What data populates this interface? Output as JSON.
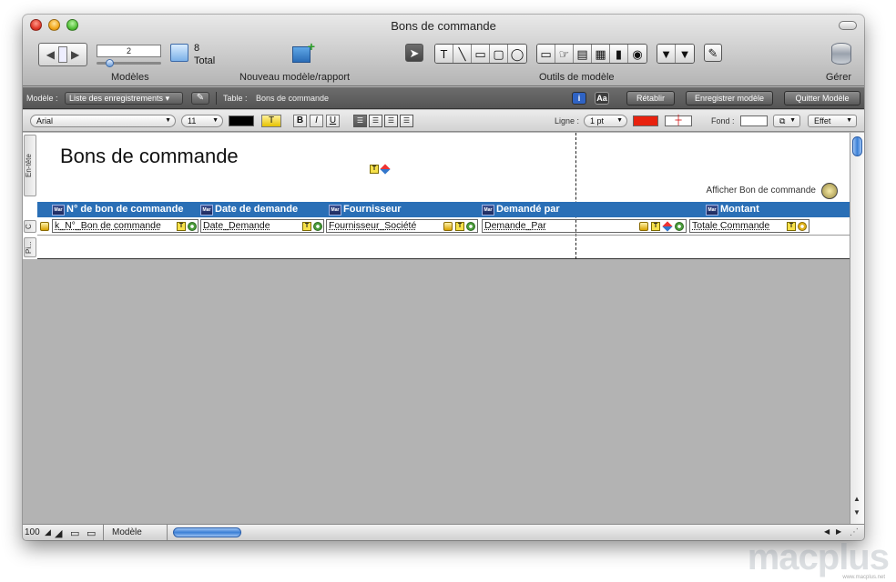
{
  "window": {
    "title": "Bons de commande"
  },
  "toolbar": {
    "record_field_value": "2",
    "total_count": "8",
    "total_label": "Total",
    "layouts_label": "Modèles",
    "new_layout_label": "Nouveau modèle/rapport",
    "layout_tools_label": "Outils de modèle",
    "manage_label": "Gérer"
  },
  "layout_bar": {
    "layout_prefix": "Modèle :",
    "layout_select": "Liste des enregistrements",
    "table_label": "Table :",
    "table_name": "Bons de commande",
    "info_badge": "i",
    "aa_badge": "Aa",
    "revert_button": "Rétablir",
    "save_button": "Enregistrer modèle",
    "exit_button": "Quitter Modèle"
  },
  "format_bar": {
    "font": "Arial",
    "size": "11",
    "text_tool": "T",
    "bold": "B",
    "italic": "I",
    "underline": "U",
    "line_label": "Ligne :",
    "line_value": "1 pt",
    "fill_label": "Fond :",
    "effect_select": "Effet",
    "line_color": "#e8210e",
    "text_color": "#000000"
  },
  "canvas": {
    "layout_title": "Bons de commande",
    "afficher_link": "Afficher Bon de commande",
    "part_header": "En-tête",
    "part_body": "C",
    "part_footer": "Pi...",
    "header_color": "#2a6fb6",
    "columns": [
      {
        "label": "N° de bon de commande",
        "field": "k_N°_Bon de commande"
      },
      {
        "label": "Date de demande",
        "field": "Date_Demande"
      },
      {
        "label": "Fournisseur",
        "field": "Fournisseur_Société"
      },
      {
        "label": "Demandé par",
        "field": "Demande_Par"
      },
      {
        "label": "Montant",
        "field": "Totale Commande"
      }
    ],
    "mar_badge": "Mar"
  },
  "status_bar": {
    "zoom": "100",
    "mode": "Modèle"
  },
  "watermark": {
    "brand": "macplus",
    "site": "www.macplus.net"
  }
}
